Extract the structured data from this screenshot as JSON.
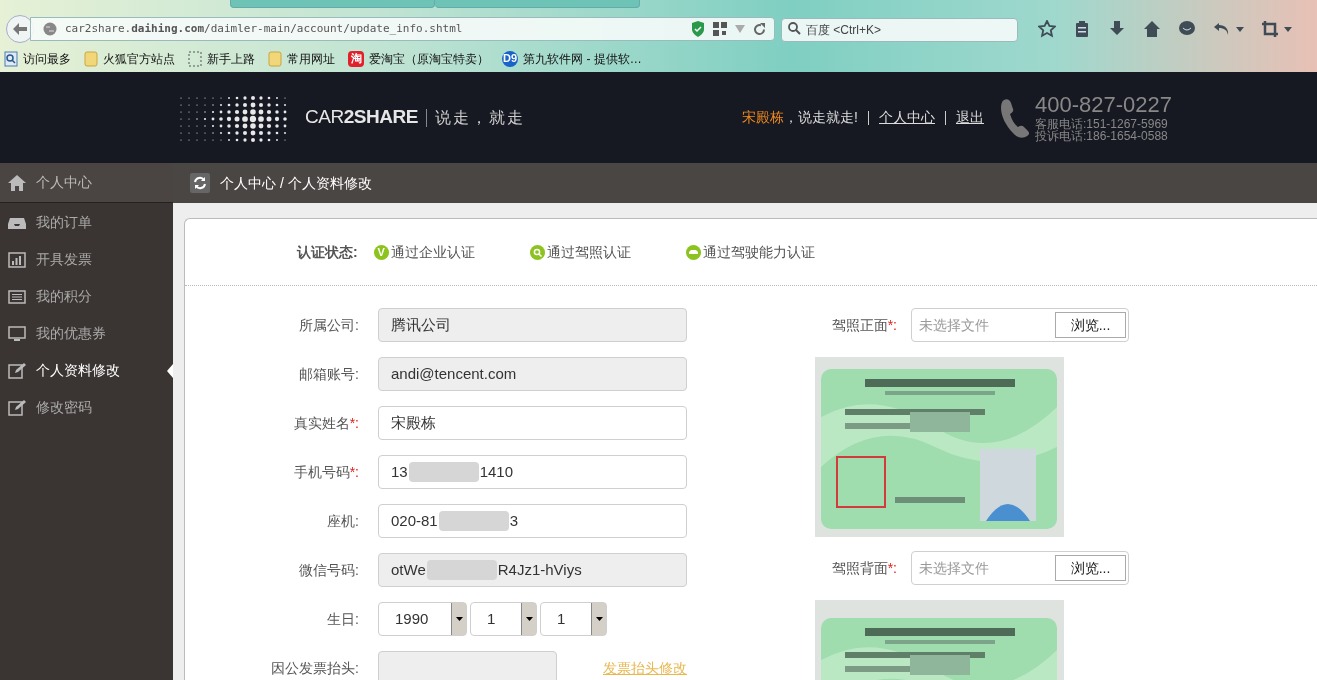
{
  "browser": {
    "url": "car2share.**daihing.com**/daimler-main/account/update_info.shtml",
    "search": {
      "placeholder": "百度 <Ctrl+K>"
    },
    "bookmarks": [
      {
        "label": "访问最多",
        "kind": "search"
      },
      {
        "label": "火狐官方站点",
        "kind": "folder"
      },
      {
        "label": "新手上路",
        "kind": "dashed"
      },
      {
        "label": "常用网址",
        "kind": "folder"
      },
      {
        "label": "爱淘宝（原淘宝特卖）",
        "kind": "badge",
        "badge": "淘",
        "color": "#e0212b"
      },
      {
        "label": "第九软件网 - 提供软…",
        "kind": "badge",
        "badge": "D9",
        "color": "#1a63c8"
      }
    ]
  },
  "header": {
    "logo": "CAR**2SHARE**",
    "slogan": "说走，就走",
    "user": "宋殿栋",
    "greeting": "，说走就走!",
    "links": [
      "个人中心",
      "退出"
    ],
    "hotline": "400-827-0227",
    "service": "客服电话:151-1267-5969",
    "complaint": "投诉电话:186-1654-0588"
  },
  "sidebar": {
    "title": "个人中心",
    "items": [
      {
        "label": "我的订单",
        "selected": false
      },
      {
        "label": "开具发票",
        "selected": false
      },
      {
        "label": "我的积分",
        "selected": false
      },
      {
        "label": "我的优惠券",
        "selected": false
      },
      {
        "label": "个人资料修改",
        "selected": true
      },
      {
        "label": "修改密码",
        "selected": false
      }
    ]
  },
  "breadcrumb": "个人中心 / 个人资料修改",
  "certification": {
    "label": "认证状态:",
    "items": [
      {
        "label": "通过企业认证",
        "badge": "V"
      },
      {
        "label": "通过驾照认证"
      },
      {
        "label": "通过驾驶能力认证"
      }
    ]
  },
  "fields": [
    {
      "label": "所属公司:",
      "kind": "text",
      "readonly": true,
      "value": [
        "腾讯公司"
      ]
    },
    {
      "label": "邮箱账号:",
      "kind": "text",
      "readonly": true,
      "value": [
        "andi@tencent.com"
      ]
    },
    {
      "label": "真实姓名",
      "required_mark": "*:",
      "kind": "text",
      "readonly": false,
      "value": [
        "宋殿栋"
      ]
    },
    {
      "label": "手机号码",
      "required_mark": "*:",
      "kind": "text",
      "readonly": false,
      "value": [
        "13",
        "1410"
      ]
    },
    {
      "label": "座机:",
      "kind": "text",
      "readonly": false,
      "value": [
        "020-81",
        "3"
      ]
    },
    {
      "label": "微信号码:",
      "kind": "text",
      "readonly": true,
      "value": [
        "otWe",
        "R4Jz1-hViys"
      ]
    },
    {
      "label": "生日:",
      "kind": "date",
      "selects": [
        "1990",
        "1",
        "1"
      ]
    },
    {
      "label": "因公发票抬头:",
      "kind": "invoice",
      "readonly": true,
      "link": "发票抬头修改"
    }
  ],
  "uploads": [
    {
      "label": "驾照正面",
      "required_mark": "*:",
      "placeholder": "未选择文件",
      "button": "浏览..."
    },
    {
      "label": "驾照背面",
      "required_mark": "*:",
      "placeholder": "未选择文件",
      "button": "浏览..."
    }
  ]
}
